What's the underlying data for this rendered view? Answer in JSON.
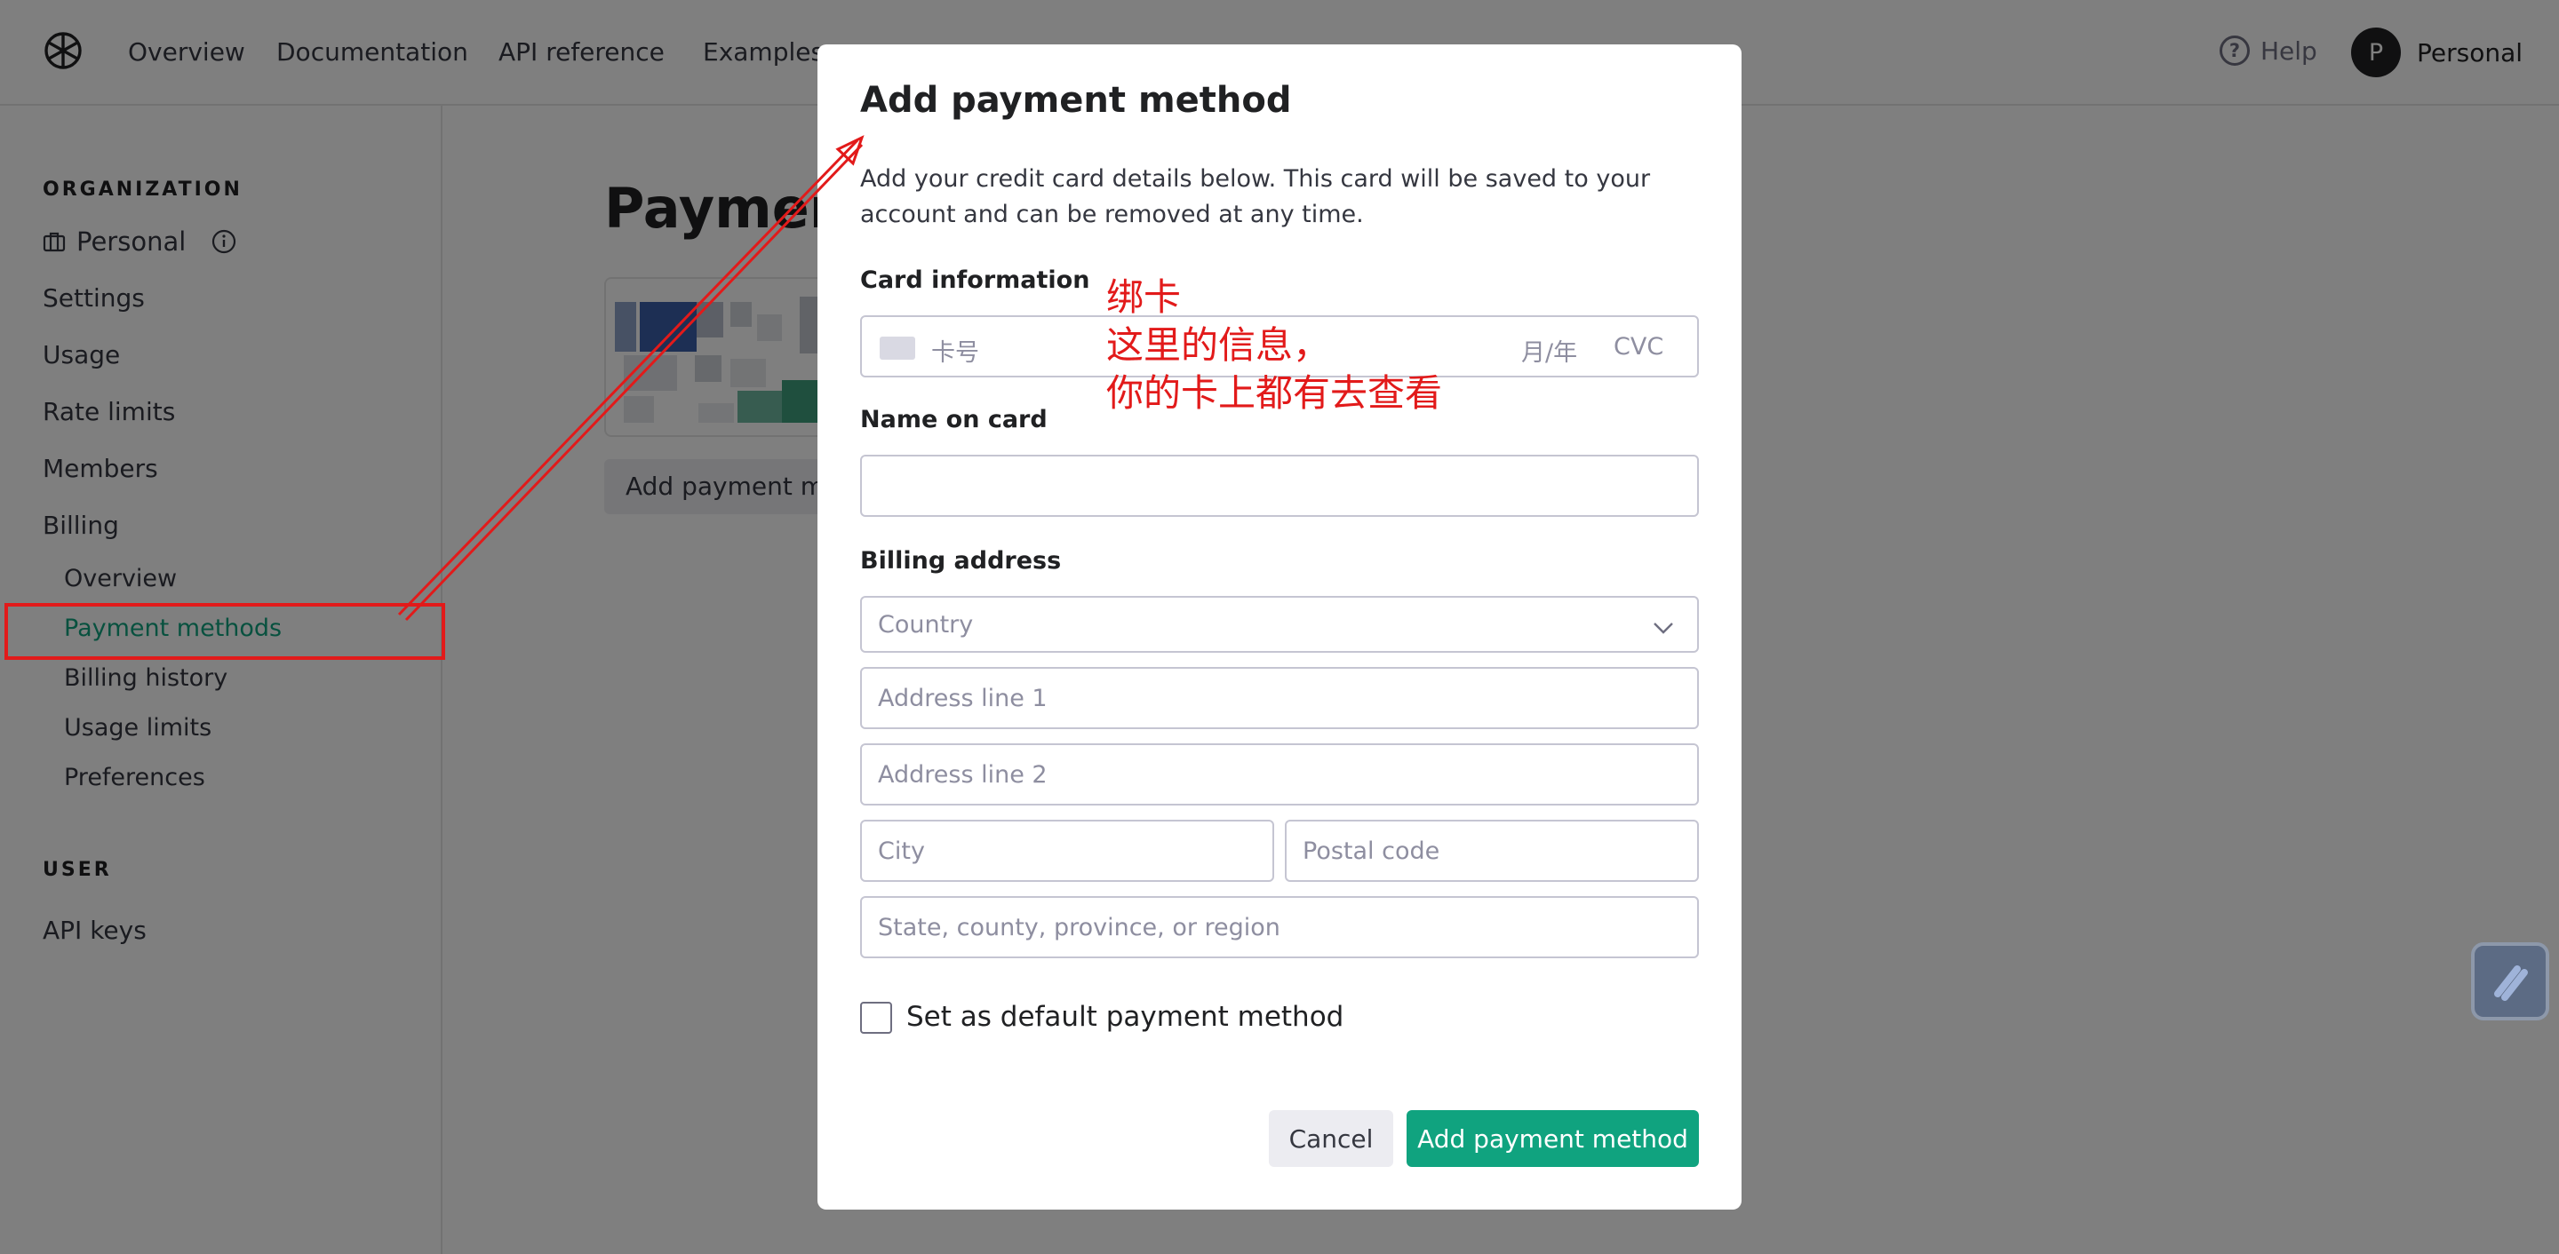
{
  "topnav": {
    "links": [
      "Overview",
      "Documentation",
      "API reference",
      "Examples"
    ],
    "help": "Help",
    "avatar_initial": "P",
    "account_name": "Personal"
  },
  "sidebar": {
    "org_section": "ORGANIZATION",
    "org_name": "Personal",
    "items": [
      "Settings",
      "Usage",
      "Rate limits",
      "Members",
      "Billing"
    ],
    "billing_sub": [
      "Overview",
      "Payment methods",
      "Billing history",
      "Usage limits",
      "Preferences"
    ],
    "active_sub": "Payment methods",
    "user_section": "USER",
    "user_items": [
      "API keys"
    ]
  },
  "main": {
    "title": "Paymen",
    "add_button": "Add payment me"
  },
  "modal": {
    "title": "Add payment method",
    "description": "Add your credit card details below. This card will be saved to your account and can be removed at any time.",
    "card_label": "Card information",
    "card_number_placeholder": "卡号",
    "card_expiry_placeholder": "月/年",
    "card_cvc_placeholder": "CVC",
    "name_label": "Name on card",
    "name_value": "",
    "billing_label": "Billing address",
    "country_placeholder": "Country",
    "address1_placeholder": "Address line 1",
    "address2_placeholder": "Address line 2",
    "city_placeholder": "City",
    "postal_placeholder": "Postal code",
    "state_placeholder": "State, county, province, or region",
    "default_checkbox_label": "Set as default payment method",
    "default_checked": false,
    "cancel_button": "Cancel",
    "submit_button": "Add payment method"
  },
  "annotation": {
    "text": "绑卡\n这里的信息，\n你的卡上都有去查看",
    "color": "#e21a1a"
  },
  "colors": {
    "accent": "#10a37f",
    "overlay": "rgba(0,0,0,0.5)"
  }
}
